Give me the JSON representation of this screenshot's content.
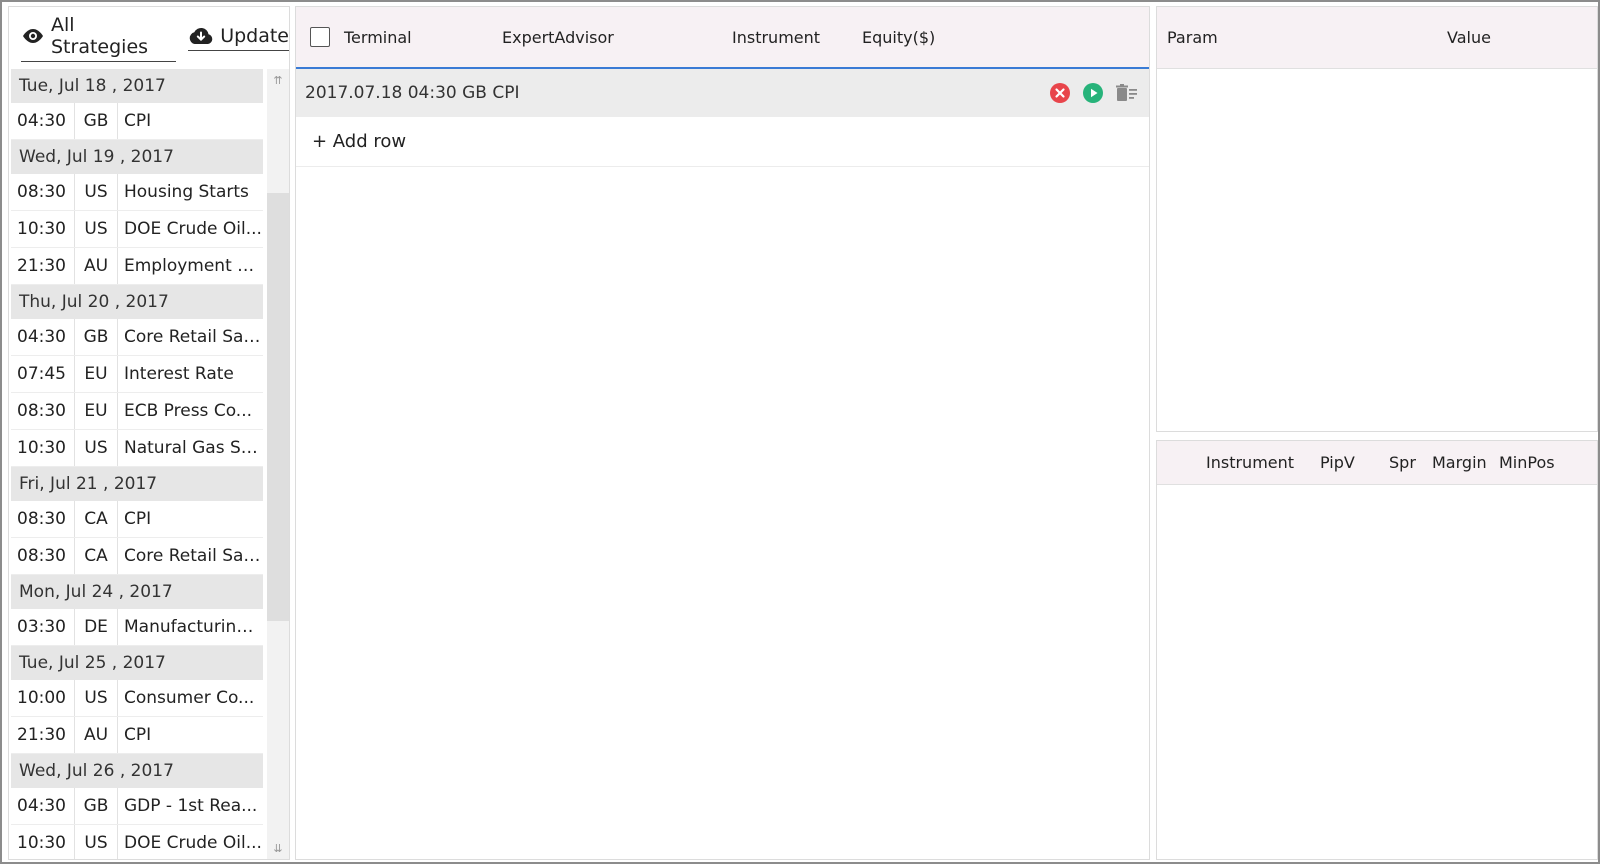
{
  "toolbar": {
    "all_strategies_label": "All Strategies",
    "update_label": "Update"
  },
  "events": [
    {
      "date": "Tue, Jul 18 , 2017",
      "items": [
        {
          "time": "04:30",
          "country": "GB",
          "name": "CPI"
        }
      ]
    },
    {
      "date": "Wed, Jul 19 , 2017",
      "items": [
        {
          "time": "08:30",
          "country": "US",
          "name": "Housing Starts"
        },
        {
          "time": "10:30",
          "country": "US",
          "name": "DOE Crude Oil..."
        },
        {
          "time": "21:30",
          "country": "AU",
          "name": "Employment C..."
        }
      ]
    },
    {
      "date": "Thu, Jul 20 , 2017",
      "items": [
        {
          "time": "04:30",
          "country": "GB",
          "name": "Core Retail Sal..."
        },
        {
          "time": "07:45",
          "country": "EU",
          "name": "Interest Rate"
        },
        {
          "time": "08:30",
          "country": "EU",
          "name": "ECB Press Co..."
        },
        {
          "time": "10:30",
          "country": "US",
          "name": "Natural Gas St..."
        }
      ]
    },
    {
      "date": "Fri, Jul 21 , 2017",
      "items": [
        {
          "time": "08:30",
          "country": "CA",
          "name": "CPI"
        },
        {
          "time": "08:30",
          "country": "CA",
          "name": "Core Retail Sal..."
        }
      ]
    },
    {
      "date": "Mon, Jul 24 , 2017",
      "items": [
        {
          "time": "03:30",
          "country": "DE",
          "name": "Manufacturing..."
        }
      ]
    },
    {
      "date": "Tue, Jul 25 , 2017",
      "items": [
        {
          "time": "10:00",
          "country": "US",
          "name": "Consumer Co..."
        },
        {
          "time": "21:30",
          "country": "AU",
          "name": "CPI"
        }
      ]
    },
    {
      "date": "Wed, Jul 26 , 2017",
      "items": [
        {
          "time": "04:30",
          "country": "GB",
          "name": "GDP - 1st Rea..."
        },
        {
          "time": "10:30",
          "country": "US",
          "name": "DOE Crude Oil..."
        }
      ]
    }
  ],
  "strategies_table": {
    "columns": [
      "Terminal",
      "ExpertAdvisor",
      "Instrument",
      "Equity($)"
    ],
    "rows": [
      {
        "label": "2017.07.18 04:30 GB CPI"
      }
    ],
    "add_row_label": "+ Add row"
  },
  "params_table": {
    "columns": [
      "Param",
      "Value"
    ]
  },
  "instruments_table": {
    "columns": [
      "Instrument",
      "PipV",
      "Spr",
      "Margin",
      "MinPos"
    ]
  },
  "colors": {
    "accent": "#3a7bd5",
    "stop": "#e8454b",
    "play": "#27b37a",
    "header_bg": "#f7f1f4"
  },
  "icons": {
    "all_strategies": "eye-icon",
    "update": "cloud-download-icon",
    "row_stop": "close-circle-icon",
    "row_play": "play-circle-icon",
    "row_delete": "delete-list-icon"
  }
}
